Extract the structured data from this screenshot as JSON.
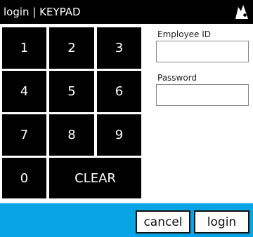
{
  "window": {
    "title": "login | KEYPAD",
    "icon": "app-logo-icon"
  },
  "keypad": {
    "keys": [
      "1",
      "2",
      "3",
      "4",
      "5",
      "6",
      "7",
      "8",
      "9",
      "0"
    ],
    "clear_label": "CLEAR"
  },
  "form": {
    "employee_id": {
      "label": "Employee ID",
      "value": ""
    },
    "password": {
      "label": "Password",
      "value": ""
    }
  },
  "actions": {
    "cancel_label": "cancel",
    "login_label": "login"
  },
  "colors": {
    "titlebar": "#000000",
    "keys": "#000000",
    "action_bar": "#08a4e6"
  }
}
